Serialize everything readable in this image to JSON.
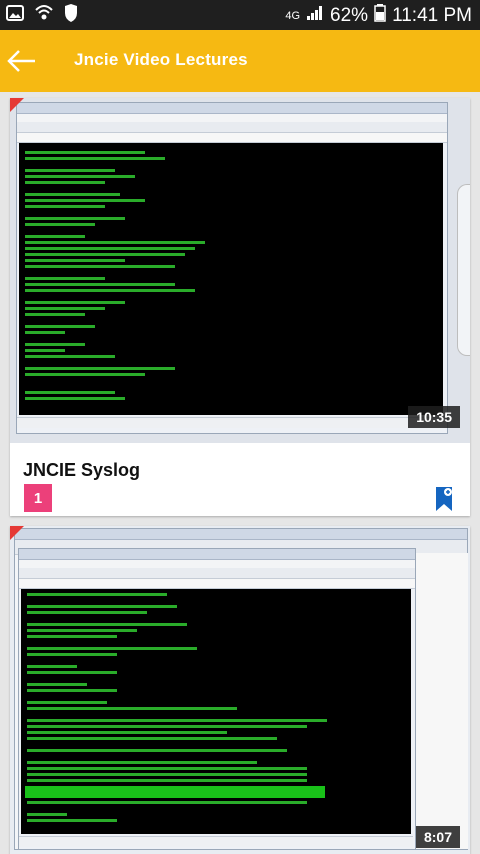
{
  "status_bar": {
    "network": "4G",
    "battery": "62%",
    "time": "11:41 PM",
    "icons": [
      "picture-icon",
      "wifi-shield-icon",
      "shield-icon",
      "signal-icon",
      "battery-icon"
    ]
  },
  "app_bar": {
    "title": "Jncie Video Lectures",
    "back_icon": "back-arrow-icon",
    "color": "#f6b912"
  },
  "videos": [
    {
      "title": "JNCIE Syslog",
      "duration": "10:35",
      "badge": "1",
      "badge_color": "#ec407a",
      "bookmark_icon": "bookmark-icon",
      "bookmark_color": "#1565c0"
    },
    {
      "duration": "8:07"
    }
  ]
}
